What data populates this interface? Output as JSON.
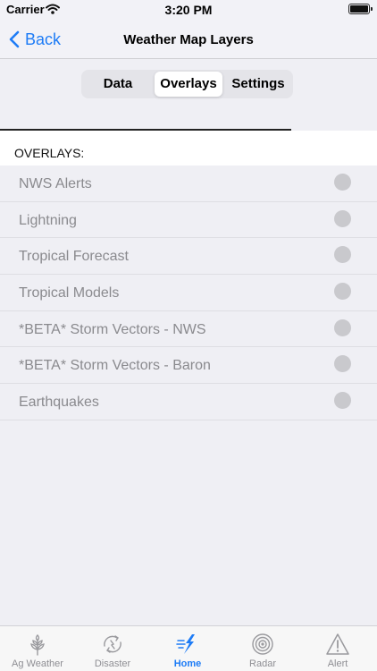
{
  "status": {
    "carrier": "Carrier",
    "time": "3:20 PM"
  },
  "nav": {
    "back_label": "Back",
    "title": "Weather Map Layers"
  },
  "segments": {
    "data": "Data",
    "overlays": "Overlays",
    "settings": "Settings",
    "selected": "Overlays"
  },
  "section": {
    "header": "OVERLAYS:"
  },
  "overlays": [
    {
      "label": "NWS Alerts",
      "enabled": false
    },
    {
      "label": "Lightning",
      "enabled": false
    },
    {
      "label": "Tropical Forecast",
      "enabled": false
    },
    {
      "label": "Tropical Models",
      "enabled": false
    },
    {
      "label": "*BETA* Storm Vectors - NWS",
      "enabled": false
    },
    {
      "label": "*BETA* Storm Vectors - Baron",
      "enabled": false
    },
    {
      "label": "Earthquakes",
      "enabled": false
    }
  ],
  "tabs": [
    {
      "label": "Ag Weather",
      "icon": "wheat-icon"
    },
    {
      "label": "Disaster",
      "icon": "disaster-icon"
    },
    {
      "label": "Home",
      "icon": "home-lightning-icon",
      "active": true
    },
    {
      "label": "Radar",
      "icon": "radar-icon"
    },
    {
      "label": "Alert",
      "icon": "alert-triangle-icon"
    }
  ],
  "colors": {
    "accent": "#1e7cf6",
    "inactive": "#8e8e93",
    "radio_off": "#c9c9cd"
  }
}
